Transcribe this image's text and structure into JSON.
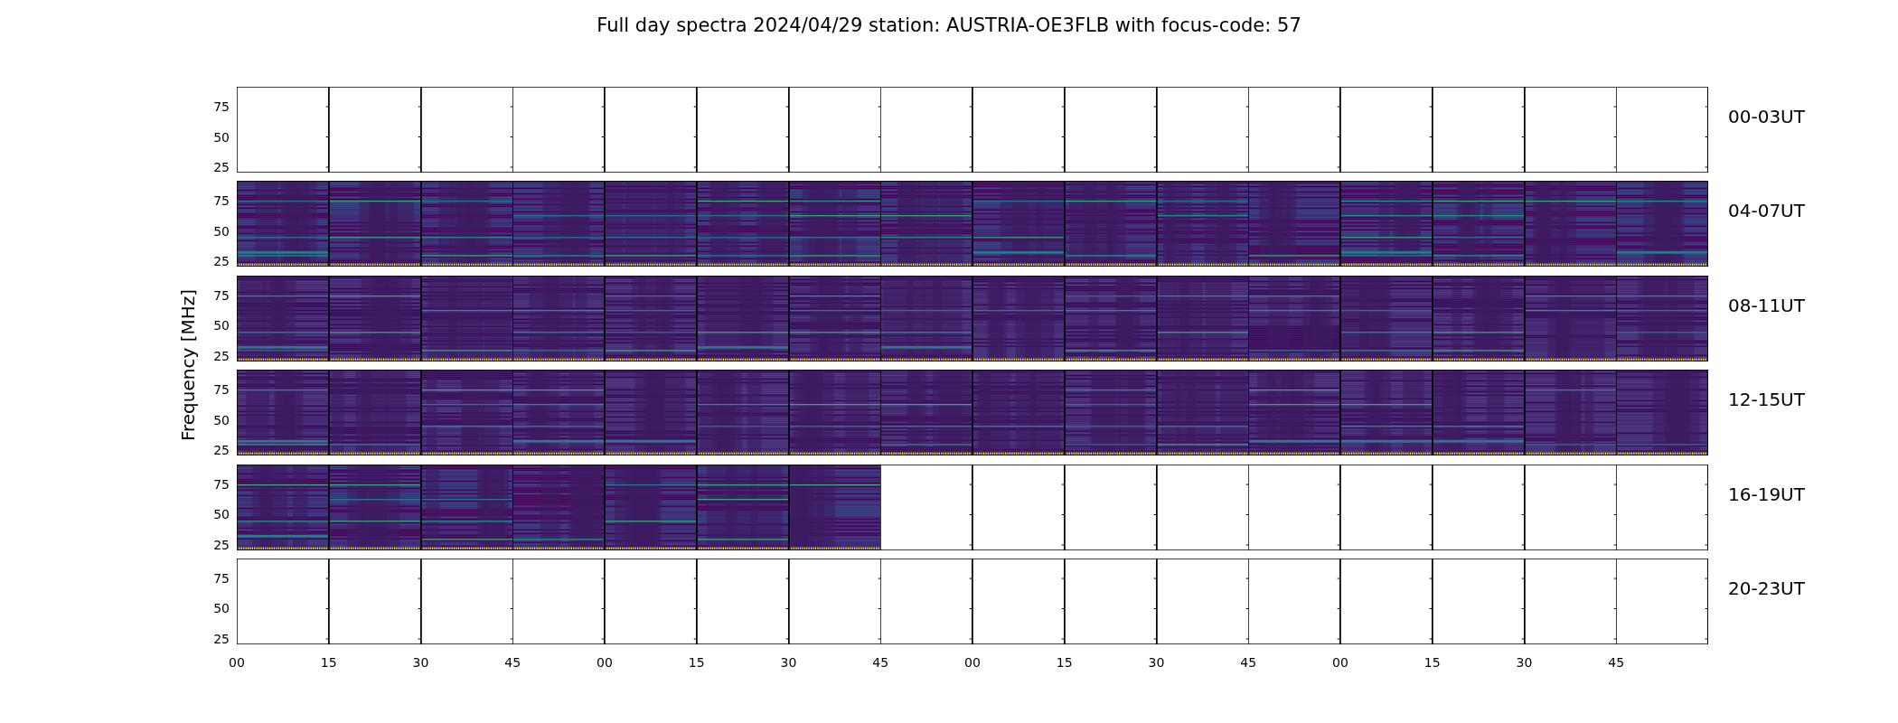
{
  "title": "Full day spectra 2024/04/29 station: AUSTRIA-OE3FLB with focus-code: 57",
  "ylabel": "Frequency [MHz]",
  "rows": [
    {
      "label": "00-03UT",
      "yticks": [
        "75",
        "50",
        "25"
      ],
      "panels": [
        {
          "has_data": false
        },
        {
          "has_data": false
        },
        {
          "has_data": false
        },
        {
          "has_data": false
        },
        {
          "has_data": false
        },
        {
          "has_data": false
        },
        {
          "has_data": false
        },
        {
          "has_data": false
        },
        {
          "has_data": false
        },
        {
          "has_data": false
        },
        {
          "has_data": false
        },
        {
          "has_data": false
        },
        {
          "has_data": false
        },
        {
          "has_data": false
        },
        {
          "has_data": false
        },
        {
          "has_data": false
        }
      ]
    },
    {
      "label": "04-07UT",
      "yticks": [
        "75",
        "50",
        "25"
      ],
      "panels": [
        {
          "has_data": true
        },
        {
          "has_data": true
        },
        {
          "has_data": true
        },
        {
          "has_data": true
        },
        {
          "has_data": true
        },
        {
          "has_data": true
        },
        {
          "has_data": true
        },
        {
          "has_data": true
        },
        {
          "has_data": true
        },
        {
          "has_data": true
        },
        {
          "has_data": true
        },
        {
          "has_data": true
        },
        {
          "has_data": true
        },
        {
          "has_data": true
        },
        {
          "has_data": true
        },
        {
          "has_data": true
        }
      ]
    },
    {
      "label": "08-11UT",
      "yticks": [
        "75",
        "50",
        "25"
      ],
      "panels": [
        {
          "has_data": true
        },
        {
          "has_data": true
        },
        {
          "has_data": true
        },
        {
          "has_data": true
        },
        {
          "has_data": true
        },
        {
          "has_data": true
        },
        {
          "has_data": true
        },
        {
          "has_data": true
        },
        {
          "has_data": true
        },
        {
          "has_data": true
        },
        {
          "has_data": true
        },
        {
          "has_data": true
        },
        {
          "has_data": true
        },
        {
          "has_data": true
        },
        {
          "has_data": true
        },
        {
          "has_data": true
        }
      ]
    },
    {
      "label": "12-15UT",
      "yticks": [
        "75",
        "50",
        "25"
      ],
      "panels": [
        {
          "has_data": true
        },
        {
          "has_data": true
        },
        {
          "has_data": true
        },
        {
          "has_data": true
        },
        {
          "has_data": true
        },
        {
          "has_data": true
        },
        {
          "has_data": true
        },
        {
          "has_data": true
        },
        {
          "has_data": true
        },
        {
          "has_data": true
        },
        {
          "has_data": true
        },
        {
          "has_data": true
        },
        {
          "has_data": true
        },
        {
          "has_data": true
        },
        {
          "has_data": true
        },
        {
          "has_data": true
        }
      ]
    },
    {
      "label": "16-19UT",
      "yticks": [
        "75",
        "50",
        "25"
      ],
      "panels": [
        {
          "has_data": true
        },
        {
          "has_data": true
        },
        {
          "has_data": true
        },
        {
          "has_data": true
        },
        {
          "has_data": true
        },
        {
          "has_data": true
        },
        {
          "has_data": true
        },
        {
          "has_data": false
        },
        {
          "has_data": false
        },
        {
          "has_data": false
        },
        {
          "has_data": false
        },
        {
          "has_data": false
        },
        {
          "has_data": false
        },
        {
          "has_data": false
        },
        {
          "has_data": false
        },
        {
          "has_data": false
        }
      ]
    },
    {
      "label": "20-23UT",
      "yticks": [
        "75",
        "50",
        "25"
      ],
      "panels": [
        {
          "has_data": false
        },
        {
          "has_data": false
        },
        {
          "has_data": false
        },
        {
          "has_data": false
        },
        {
          "has_data": false
        },
        {
          "has_data": false
        },
        {
          "has_data": false
        },
        {
          "has_data": false
        },
        {
          "has_data": false
        },
        {
          "has_data": false
        },
        {
          "has_data": false
        },
        {
          "has_data": false
        },
        {
          "has_data": false
        },
        {
          "has_data": false
        },
        {
          "has_data": false
        },
        {
          "has_data": false
        }
      ]
    }
  ],
  "xticks": [
    "00",
    "15",
    "30",
    "45",
    "00",
    "15",
    "30",
    "45",
    "00",
    "15",
    "30",
    "45",
    "00",
    "15",
    "30",
    "45"
  ]
}
